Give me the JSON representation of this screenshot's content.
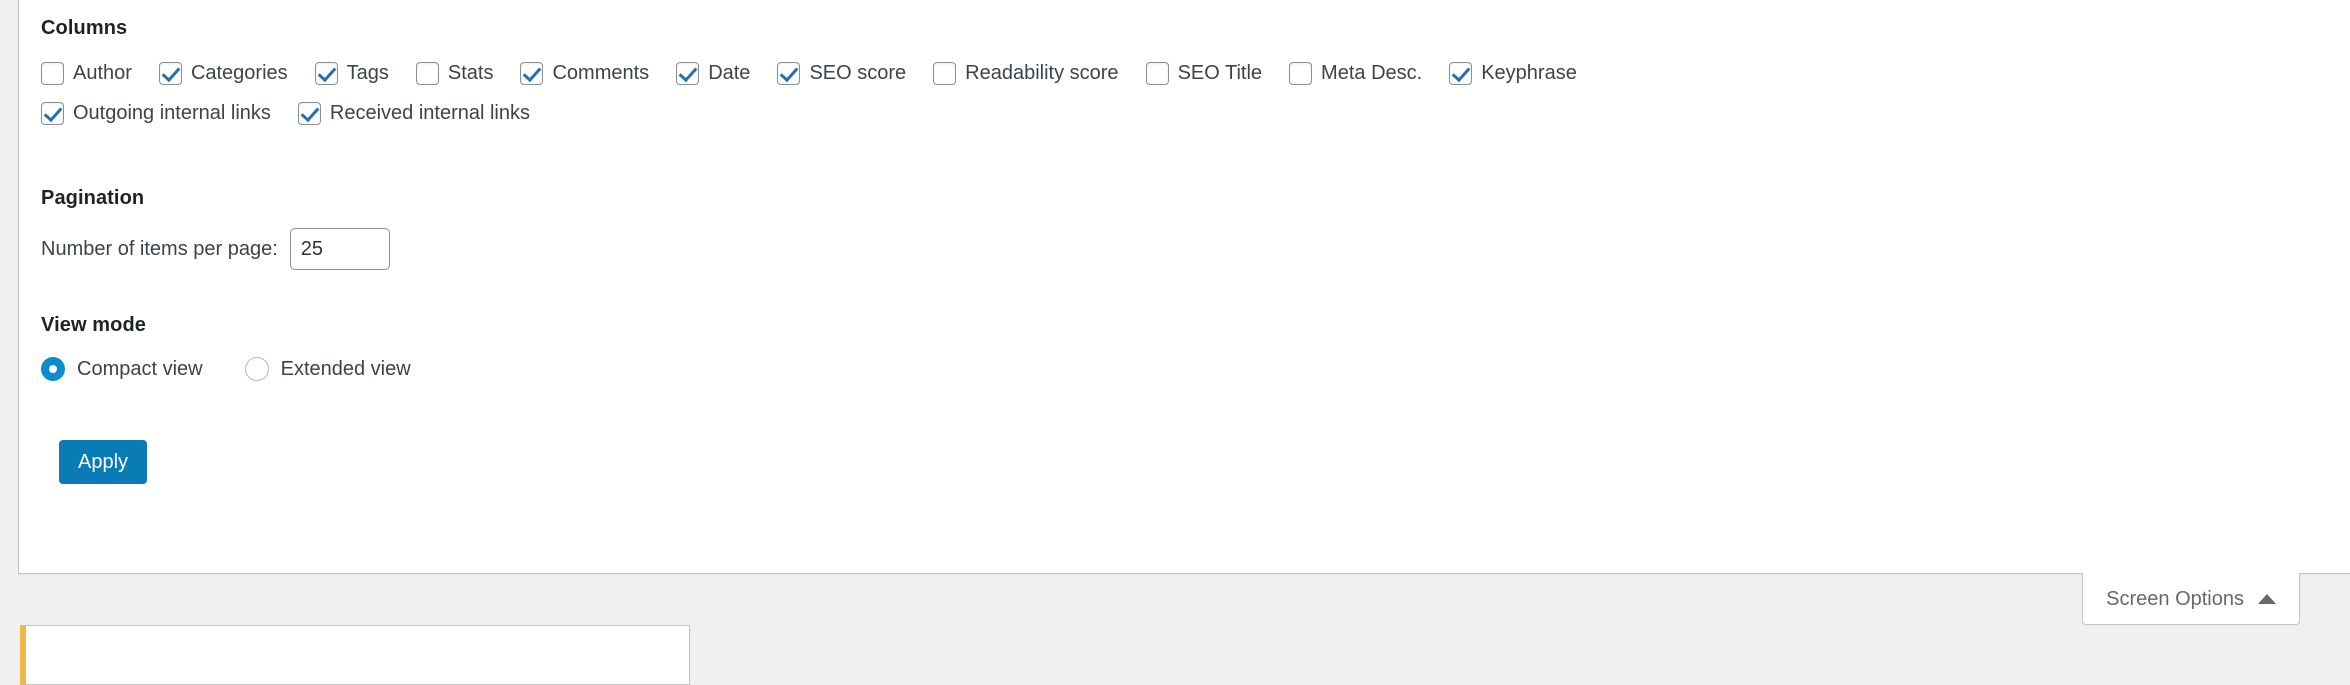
{
  "screen_options": {
    "columns": {
      "title": "Columns",
      "rows": [
        [
          {
            "label": "Author",
            "checked": false
          },
          {
            "label": "Categories",
            "checked": true
          },
          {
            "label": "Tags",
            "checked": true
          },
          {
            "label": "Stats",
            "checked": false
          },
          {
            "label": "Comments",
            "checked": true
          },
          {
            "label": "Date",
            "checked": true
          },
          {
            "label": "SEO score",
            "checked": true
          },
          {
            "label": "Readability score",
            "checked": false
          },
          {
            "label": "SEO Title",
            "checked": false
          },
          {
            "label": "Meta Desc.",
            "checked": false
          },
          {
            "label": "Keyphrase",
            "checked": true
          }
        ],
        [
          {
            "label": "Outgoing internal links",
            "checked": true
          },
          {
            "label": "Received internal links",
            "checked": true
          }
        ]
      ]
    },
    "pagination": {
      "title": "Pagination",
      "per_page_label": "Number of items per page:",
      "per_page_value": "25"
    },
    "view_mode": {
      "title": "View mode",
      "options": [
        {
          "label": "Compact view",
          "selected": true
        },
        {
          "label": "Extended view",
          "selected": false
        }
      ]
    },
    "apply_label": "Apply"
  },
  "screen_options_tab": {
    "label": "Screen Options",
    "caret": "caret-up-icon"
  },
  "colors": {
    "accent_blue": "#2271b1",
    "button_blue": "#0a7cb5",
    "radio_blue": "#0c8ccd",
    "notice_amber": "#f0b849",
    "text_dark": "#3c434a",
    "text_muted": "#646970",
    "border_gray": "#c3c4c7",
    "page_bg": "#f0f0f1"
  }
}
